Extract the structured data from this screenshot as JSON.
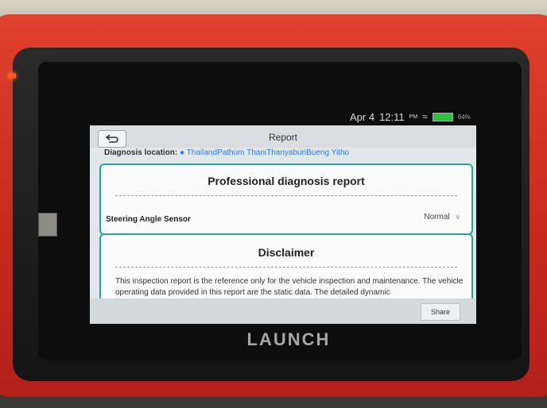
{
  "device": {
    "brand": "LAUNCH"
  },
  "status_bar": {
    "date": "Apr 4",
    "time": "12:11",
    "ampm": "PM",
    "battery_label": "64%"
  },
  "screen": {
    "title": "Report",
    "location_label": "Diagnosis location:",
    "location_value": "ThailandPathum ThaniThanyaburiBueng Yitho",
    "report_heading": "Professional diagnosis report",
    "sensor": {
      "name": "Steering Angle Sensor",
      "status": "Normal"
    },
    "disclaimer_heading": "Disclaimer",
    "disclaimer_text": "This inspection report is the reference only for the vehicle inspection and maintenance. The vehicle operating data provided in this report are the static data. The detailed dynamic",
    "share_label": "Share"
  },
  "colors": {
    "device_red": "#d0332a",
    "accent_teal": "#1fa89c",
    "location_blue": "#2f7de1"
  }
}
